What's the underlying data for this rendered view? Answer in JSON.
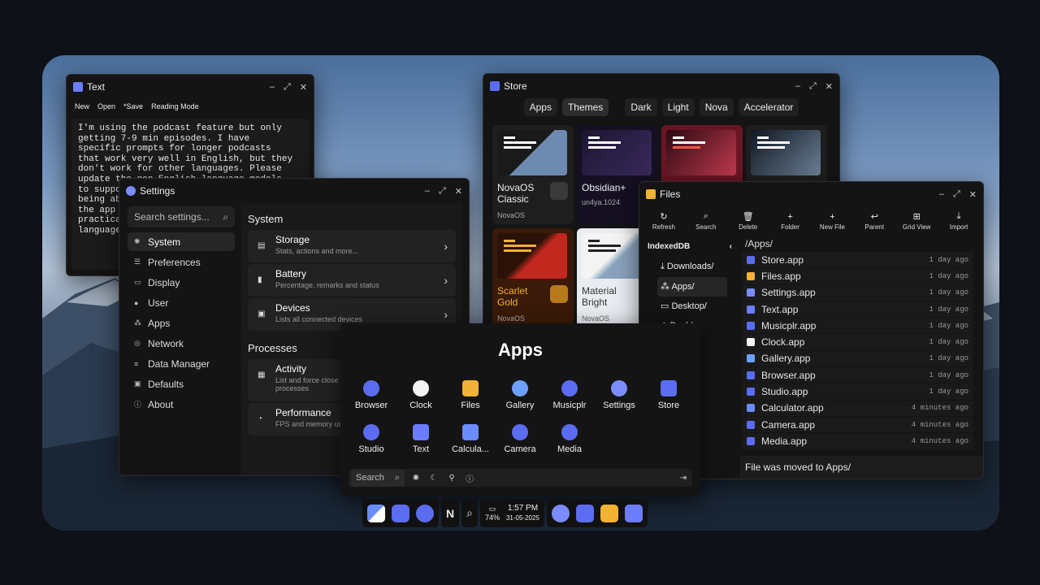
{
  "text_win": {
    "title": "Text",
    "menu": [
      "New",
      "Open",
      "*Save",
      "Reading Mode"
    ],
    "content": "I'm using the podcast feature but only\ngetting 7-9 min episodes. I have\nspecific prompts for longer podcasts\nthat work very well in English, but they\ndon't work for other languages. Please\nupdate the non-English language models\nto support longer podcasts. This is\nbeing able to use the podcast feature in\nthe app for other languages would be\npractical for learning other\nlanguages."
  },
  "store": {
    "title": "Store",
    "tabs": [
      "Apps",
      "Themes"
    ],
    "filters": [
      "Dark",
      "Light",
      "Nova",
      "Accelerator"
    ],
    "themes": [
      {
        "name": "NovaOS Classic",
        "author": "NovaOS"
      },
      {
        "name": "Obsidian+",
        "author": "un4ya.1024"
      },
      {
        "name": "",
        "author": ""
      },
      {
        "name": "",
        "author": ""
      },
      {
        "name": "Scarlet Gold",
        "author": "NovaOS"
      },
      {
        "name": "Material Bright",
        "author": "NovaOS"
      }
    ]
  },
  "files": {
    "title": "Files",
    "toolbar": [
      "Refresh",
      "Search",
      "Delete",
      "Folder",
      "New File",
      "Parent",
      "Grid View",
      "Import"
    ],
    "sidebar_header": "IndexedDB",
    "nav": [
      "Downloads/",
      "Apps/",
      "Desktop/",
      "Desk/"
    ],
    "path": "/Apps/",
    "rows": [
      {
        "name": "Store.app",
        "time": "1 day ago",
        "color": "#5b6cf0"
      },
      {
        "name": "Files.app",
        "time": "1 day ago",
        "color": "#f2b233"
      },
      {
        "name": "Settings.app",
        "time": "1 day ago",
        "color": "#7b8cff"
      },
      {
        "name": "Text.app",
        "time": "1 day ago",
        "color": "#6b7cff"
      },
      {
        "name": "Musicplr.app",
        "time": "1 day ago",
        "color": "#5b6cf0"
      },
      {
        "name": "Clock.app",
        "time": "1 day ago",
        "color": "#f4f4f4"
      },
      {
        "name": "Gallery.app",
        "time": "1 day ago",
        "color": "#6ea0ff"
      },
      {
        "name": "Browser.app",
        "time": "1 day ago",
        "color": "#5b6cf0"
      },
      {
        "name": "Studio.app",
        "time": "1 day ago",
        "color": "#5b6cf0"
      },
      {
        "name": "Calculator.app",
        "time": "4 minutes ago",
        "color": "#6b8cff"
      },
      {
        "name": "Camera.app",
        "time": "4 minutes ago",
        "color": "#5b6cf0"
      },
      {
        "name": "Media.app",
        "time": "4 minutes ago",
        "color": "#5b6cf0"
      }
    ],
    "status": "File was moved to Apps/"
  },
  "settings": {
    "title": "Settings",
    "search_placeholder": "Search settings...",
    "nav": [
      "System",
      "Preferences",
      "Display",
      "User",
      "Apps",
      "Network",
      "Data Manager",
      "Defaults",
      "About"
    ],
    "system_header": "System",
    "system_items": [
      {
        "title": "Storage",
        "desc": "Stats, actions and more..."
      },
      {
        "title": "Battery",
        "desc": "Percentage, remarks and status"
      },
      {
        "title": "Devices",
        "desc": "Lists all connected devices"
      }
    ],
    "processes_header": "Processes",
    "process_items": [
      {
        "title": "Activity",
        "desc": "List and force close processes"
      },
      {
        "title": "Performance",
        "desc": "FPS and memory usage"
      }
    ]
  },
  "launcher": {
    "title": "Apps",
    "apps": [
      "Browser",
      "Clock",
      "Files",
      "Gallery",
      "Musicplr",
      "Settings",
      "Store",
      "Studio",
      "Text",
      "Calcula...",
      "Camera",
      "Media"
    ],
    "search": "Search"
  },
  "taskbar": {
    "battery": "74%",
    "time": "1:57 PM",
    "date": "31-05-2025"
  }
}
